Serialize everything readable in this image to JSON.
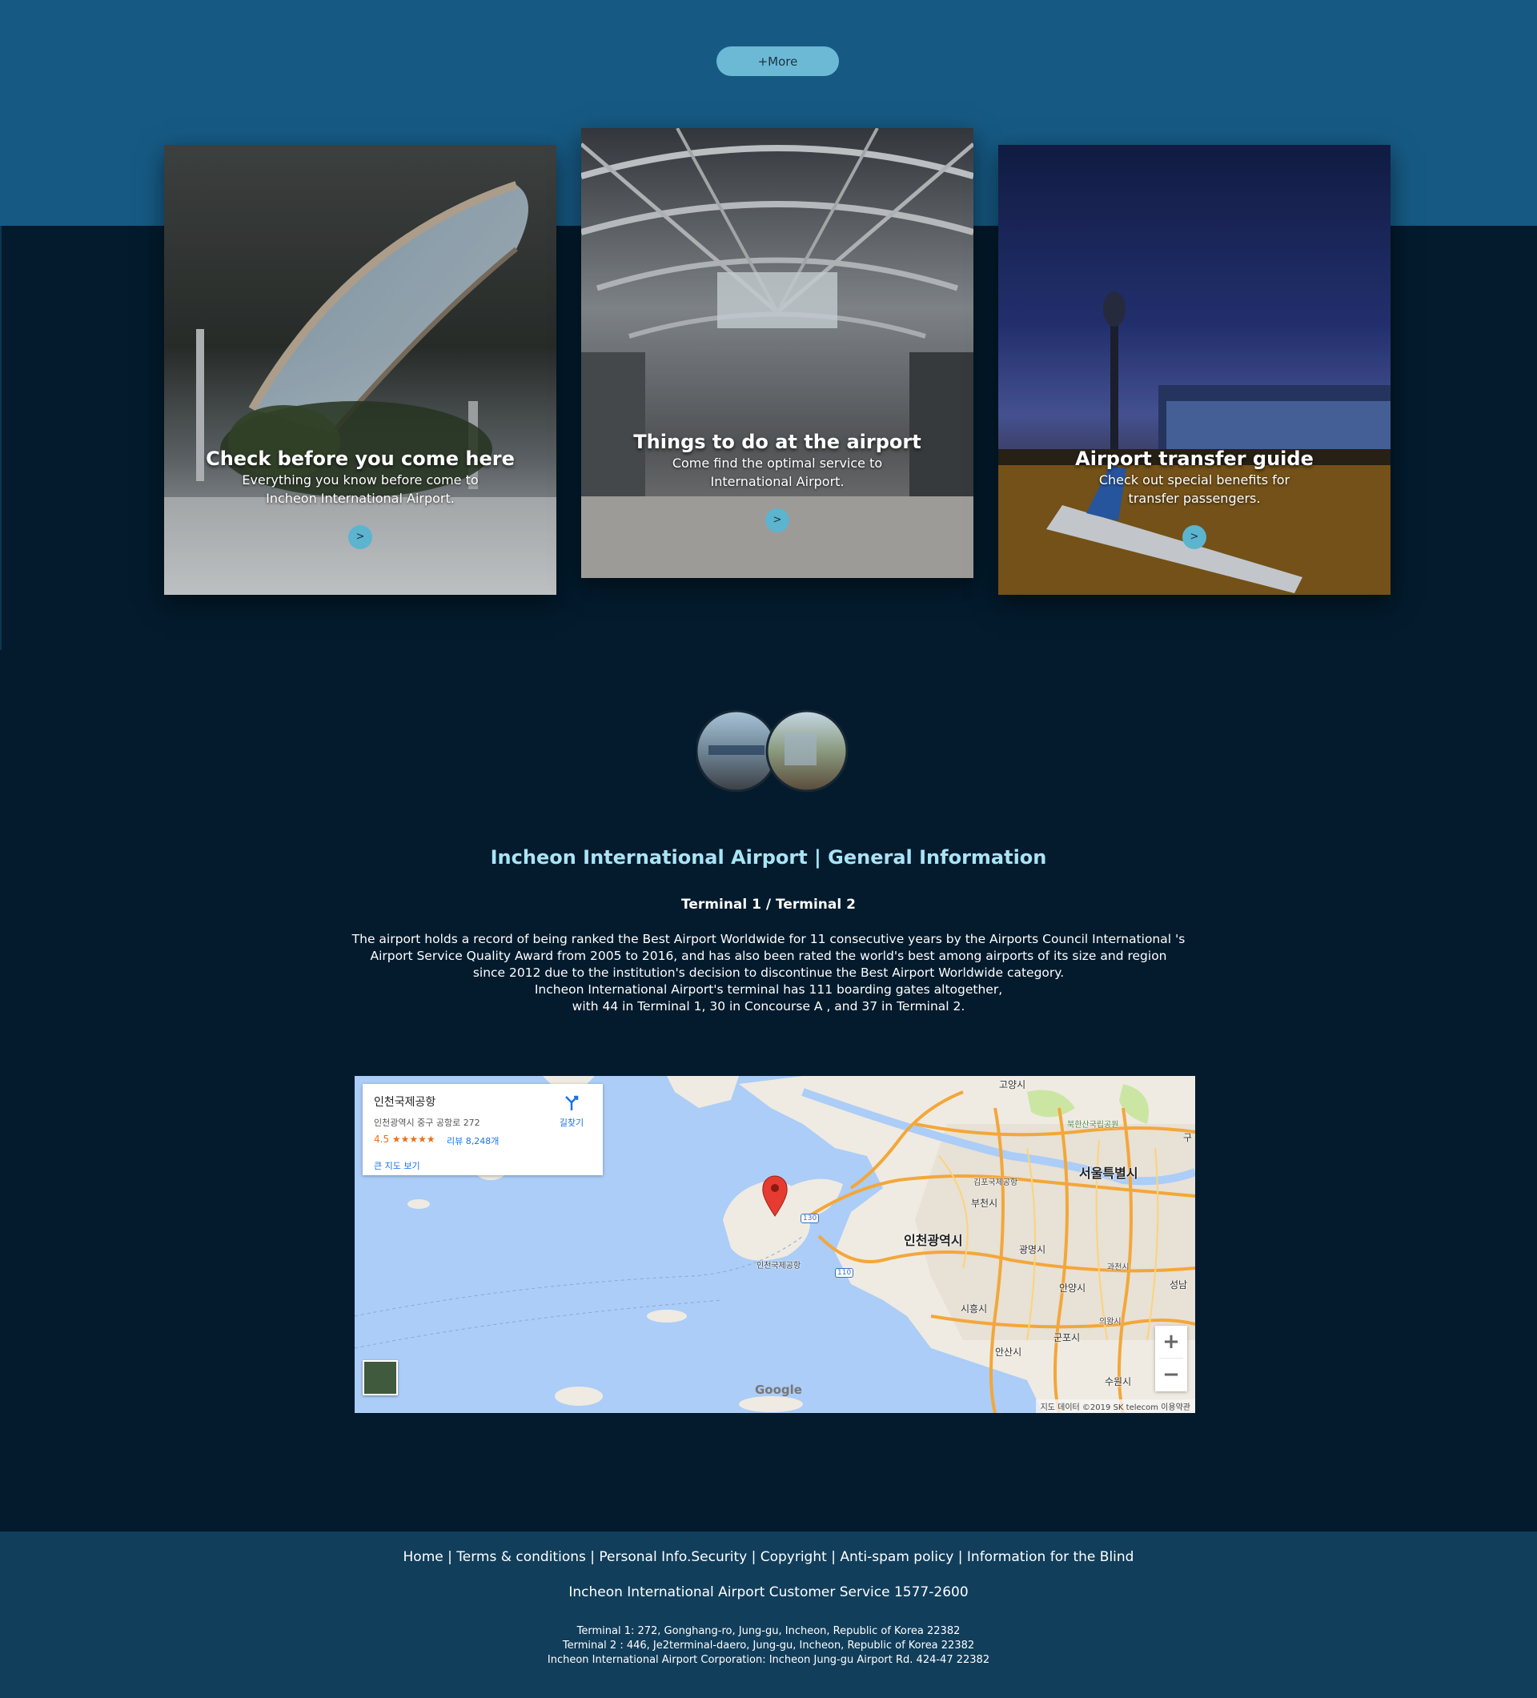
{
  "more_button": "+More",
  "cards": [
    {
      "title": "Check before you come here",
      "desc1": "Everything you know before come to",
      "desc2": "Incheon International Airport.",
      "arrow": ">"
    },
    {
      "title": "Things to do at the airport",
      "desc1": "Come find the optimal service to",
      "desc2": "International Airport.",
      "arrow": ">"
    },
    {
      "title": "Airport transfer guide",
      "desc1": "Check out special benefits for",
      "desc2": "transfer passengers.",
      "arrow": ">"
    }
  ],
  "info": {
    "title": "Incheon International Airport | General Information",
    "subtitle": "Terminal 1 / Terminal 2",
    "lines": [
      "The airport holds a record of being ranked the Best Airport Worldwide for 11 consecutive years by the Airports Council International 's",
      "Airport Service Quality Award from 2005 to 2016, and has also been rated the world's best among airports of its size and region",
      "since 2012 due to the institution's decision to discontinue the Best Airport Worldwide category.",
      "Incheon International Airport's terminal has 111 boarding gates altogether,",
      "with 44 in Terminal 1, 30 in Concourse A , and 37 in Terminal 2."
    ]
  },
  "map": {
    "place_name": "인천국제공항",
    "address": "인천광역시 중구 공항로 272",
    "rating": "4.5 ★★★★★",
    "reviews": "리뷰 8,248개",
    "large_map": "큰 지도 보기",
    "directions": "길찾기",
    "zoom_in": "+",
    "zoom_out": "−",
    "google": "Google",
    "attribution": "지도 데이터 ©2019 SK telecom   이용약관",
    "labels": {
      "goyang": "고양시",
      "bukhansan": "북한산국립공원",
      "seoul": "서울특별시",
      "gimpo_airport": "김포국제공항",
      "bucheon": "부천시",
      "incheon": "인천광역시",
      "gwangmyeong": "광명시",
      "gwacheon": "과천시",
      "anyang": "안양시",
      "seongnam": "성남",
      "siheung": "시흥시",
      "uiwang": "의왕시",
      "gunpo": "군포시",
      "ansan": "안산시",
      "suwon": "수원시",
      "airport": "인천국제공항",
      "gu": "구",
      "route130": "130",
      "route110": "110"
    }
  },
  "footer": {
    "links": [
      "Home",
      "Terms & conditions",
      "Personal Info.Security",
      "Copyright",
      "Anti-spam policy",
      "Information for the Blind"
    ],
    "separator": " | ",
    "service": "Incheon International Airport Customer Service 1577-2600",
    "addr1": "Terminal 1: 272, Gonghang-ro, Jung-gu, Incheon, Republic of Korea 22382",
    "addr2": "Terminal 2 : 446, Je2terminal-daero, Jung-gu, Incheon, Republic of Korea 22382",
    "addr3": "Incheon International Airport Corporation: Incheon Jung-gu Airport Rd. 424-47 22382"
  }
}
